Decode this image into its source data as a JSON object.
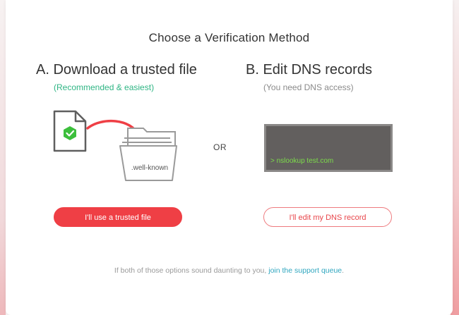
{
  "dialog": {
    "title": "Choose a Verification Method",
    "option_a": {
      "heading": "A. Download a trusted file",
      "subheading": "(Recommended & easiest)",
      "folder_label": ".well-known",
      "button_label": "I'll use a trusted file"
    },
    "separator": "OR",
    "option_b": {
      "heading": "B. Edit DNS records",
      "subheading": "(You need DNS access)",
      "terminal_text": "> nslookup test.com",
      "button_label": "I'll edit my DNS record"
    },
    "footer": {
      "text": "If both of those options sound daunting to you, ",
      "link_text": "join the support queue",
      "suffix": "."
    }
  },
  "colors": {
    "accent_red": "#ef3f45",
    "green_subheading": "#2fb584",
    "gray_subheading": "#8a8a8a",
    "link": "#2fa6bf",
    "terminal_bg": "#625f5e",
    "terminal_text": "#7ddc4b",
    "check_green": "#3cbf3c"
  },
  "icons": {
    "document": "document-check-icon",
    "arrow": "curved-arrow-icon",
    "folder": "folder-icon"
  }
}
